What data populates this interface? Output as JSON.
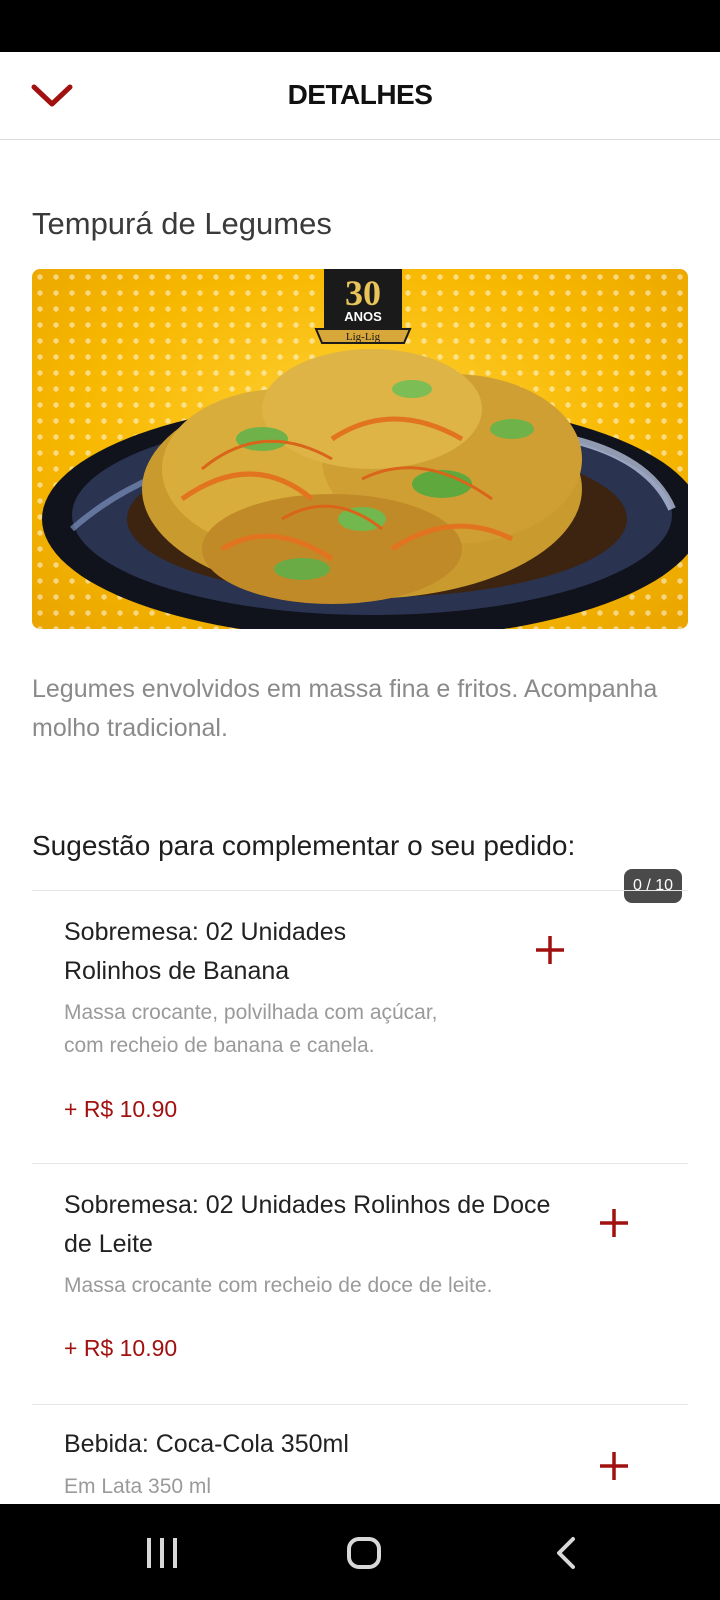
{
  "header": {
    "title": "DETALHES",
    "back_icon": "chevron-down-icon",
    "accent_color": "#a0110f"
  },
  "product": {
    "name": "Tempurá de Legumes",
    "image_badge": {
      "number": "30",
      "label": "ANOS",
      "brand": "Lig-Lig"
    },
    "description": "Legumes envolvidos em massa fina e fritos. Acompanha molho tradicional."
  },
  "suggestions": {
    "title": "Sugestão para complementar o seu pedido:",
    "counter": "0 / 10",
    "items": [
      {
        "name": "Sobremesa: 02 Unidades Rolinhos de Banana",
        "description": "Massa crocante, polvilhada com açúcar, com recheio de banana e canela.",
        "price": "+ R$ 10.90",
        "add_icon": "plus-icon"
      },
      {
        "name": "Sobremesa: 02 Unidades Rolinhos de Doce de Leite",
        "description": "Massa crocante com recheio de doce de leite.",
        "price": "+ R$ 10.90",
        "add_icon": "plus-icon"
      },
      {
        "name": "Bebida: Coca-Cola 350ml",
        "description": "Em Lata 350 ml",
        "add_icon": "plus-icon"
      }
    ]
  },
  "nav": {
    "recents_icon": "recent-apps-icon",
    "home_icon": "home-icon",
    "back_icon": "back-icon"
  }
}
